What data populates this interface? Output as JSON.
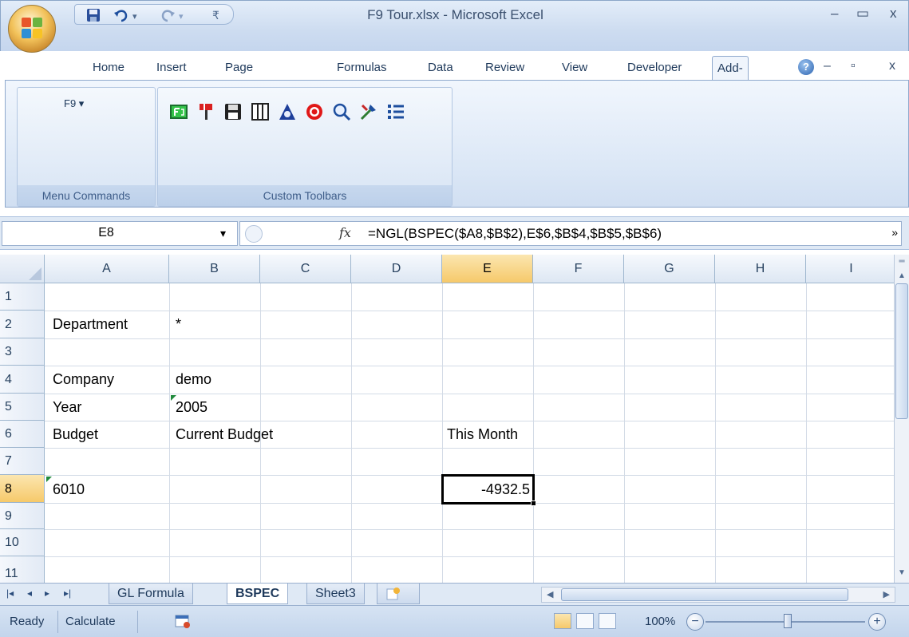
{
  "window": {
    "title": "F9 Tour.xlsx - Microsoft Excel",
    "minimize": "–",
    "maximize": "▭",
    "close": "x",
    "doc_minimize": "–",
    "doc_restore": "▫",
    "doc_close": "x"
  },
  "qat": {
    "save_icon": "save-icon",
    "undo_icon": "undo-icon",
    "redo_icon": "redo-icon",
    "customize_icon": "customize-qat-icon"
  },
  "tabs": [
    "Home",
    "Insert",
    "Page Layout",
    "Formulas",
    "Data",
    "Review",
    "View",
    "Developer",
    "Add-Ins"
  ],
  "active_tab": "Add-Ins",
  "help": "?",
  "ribbon": {
    "menu_commands": {
      "f9_menu": "F9 ▾",
      "label": "Menu Commands"
    },
    "custom_toolbars": {
      "label": "Custom Toolbars",
      "icons": [
        "f9-icon",
        "paint-icon",
        "save-disk-icon",
        "columns-icon",
        "triangle-icon",
        "stop-icon",
        "zoom-icon",
        "tools-icon",
        "list-icon"
      ]
    }
  },
  "formula_bar": {
    "name_box": "E8",
    "name_box_arrow": "▾",
    "fx": "fx",
    "formula": "=NGL(BSPEC($A8,$B$2),E$6,$B$4,$B$5,$B$6)",
    "expand": "»"
  },
  "grid": {
    "columns": [
      "A",
      "B",
      "C",
      "D",
      "E",
      "F",
      "G",
      "H",
      "I"
    ],
    "selected_column": "E",
    "rows": [
      "1",
      "2",
      "3",
      "4",
      "5",
      "6",
      "7",
      "8",
      "9",
      "10",
      "11"
    ],
    "selected_row": "8",
    "cells": {
      "A2": "Department",
      "B2": "*",
      "A4": "Company",
      "B4": "demo",
      "A5": "Year",
      "B5": "2005",
      "A6": "Budget",
      "B6": "Current Budget",
      "E6": "This Month",
      "A8": "6010",
      "E8": "-4932.5"
    }
  },
  "sheets": {
    "nav": [
      "|◂",
      "◂",
      "▸",
      "▸|"
    ],
    "tabs": [
      "GL Formula",
      "BSPEC",
      "Sheet3"
    ],
    "active": "BSPEC",
    "insert_icon": "insert-sheet-icon"
  },
  "status": {
    "ready": "Ready",
    "calculate": "Calculate",
    "zoom": "100%",
    "zoom_out": "−",
    "zoom_in": "+"
  },
  "colors": {
    "ribbon_bg": "#dbe7f6",
    "selected_header": "#f6c96a",
    "error_indicator": "#1f8a3c"
  }
}
